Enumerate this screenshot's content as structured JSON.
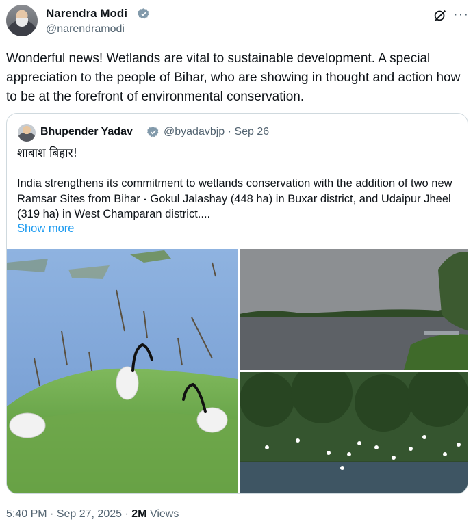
{
  "post": {
    "author_name": "Narendra Modi",
    "author_handle": "@narendramodi",
    "text": "Wonderful news! Wetlands are vital to sustainable development. A special appreciation to the people of Bihar, who are showing in thought and action how to be at the forefront of environmental conservation.",
    "icons": {
      "grok": "grok-icon",
      "more": "more-icon",
      "verified": "verified-badge-icon"
    }
  },
  "quote": {
    "author_name": "Bhupender Yadav",
    "author_handle": "@byadavbjp",
    "separator": "·",
    "date": "Sep 26",
    "line1": "शाबाश बिहार!",
    "body": "India strengthens its commitment to wetlands conservation with the addition of two new Ramsar Sites from Bihar - Gokul Jalashay (448 ha) in Buxar district, and Udaipur Jheel (319 ha) in West Champaran district....",
    "show_more": "Show more"
  },
  "footer": {
    "time": "5:40 PM",
    "sep1": "·",
    "date": "Sep 27, 2025",
    "sep2": "·",
    "views_count": "2M",
    "views_label": "Views"
  }
}
